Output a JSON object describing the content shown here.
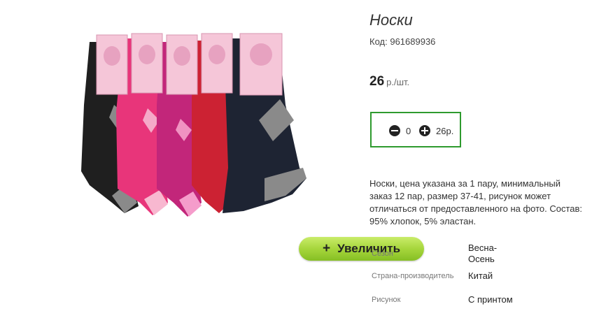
{
  "product": {
    "title": "Носки",
    "code_label": "Код:",
    "code": "961689936",
    "price_value": "26",
    "price_unit": "р./шт."
  },
  "photo": {
    "icon": "product-photo-socks",
    "zoom_plus": "+",
    "zoom_label": "Увеличить"
  },
  "quantity": {
    "value": "0",
    "total": "26р."
  },
  "description": "Носки, цена указана за 1 пару, минимальный заказ 12 пар, размер 37-41, рисунок может отличаться от предоставленного на фото. Состав: 95% хлопок, 5% эластан.",
  "attributes": [
    {
      "key": "Сезон",
      "value": "Весна-Осень"
    },
    {
      "key": "Страна-производитель",
      "value": "Китай"
    },
    {
      "key": "Рисунок",
      "value": "С принтом"
    }
  ],
  "colors": {
    "accent_green": "#2e9a2e",
    "button_green": "#a6d63c",
    "sock_black": "#222222",
    "sock_pink": "#e8357a",
    "sock_magenta": "#c2267a",
    "sock_red": "#cc2233",
    "sock_navy": "#1e2433"
  }
}
